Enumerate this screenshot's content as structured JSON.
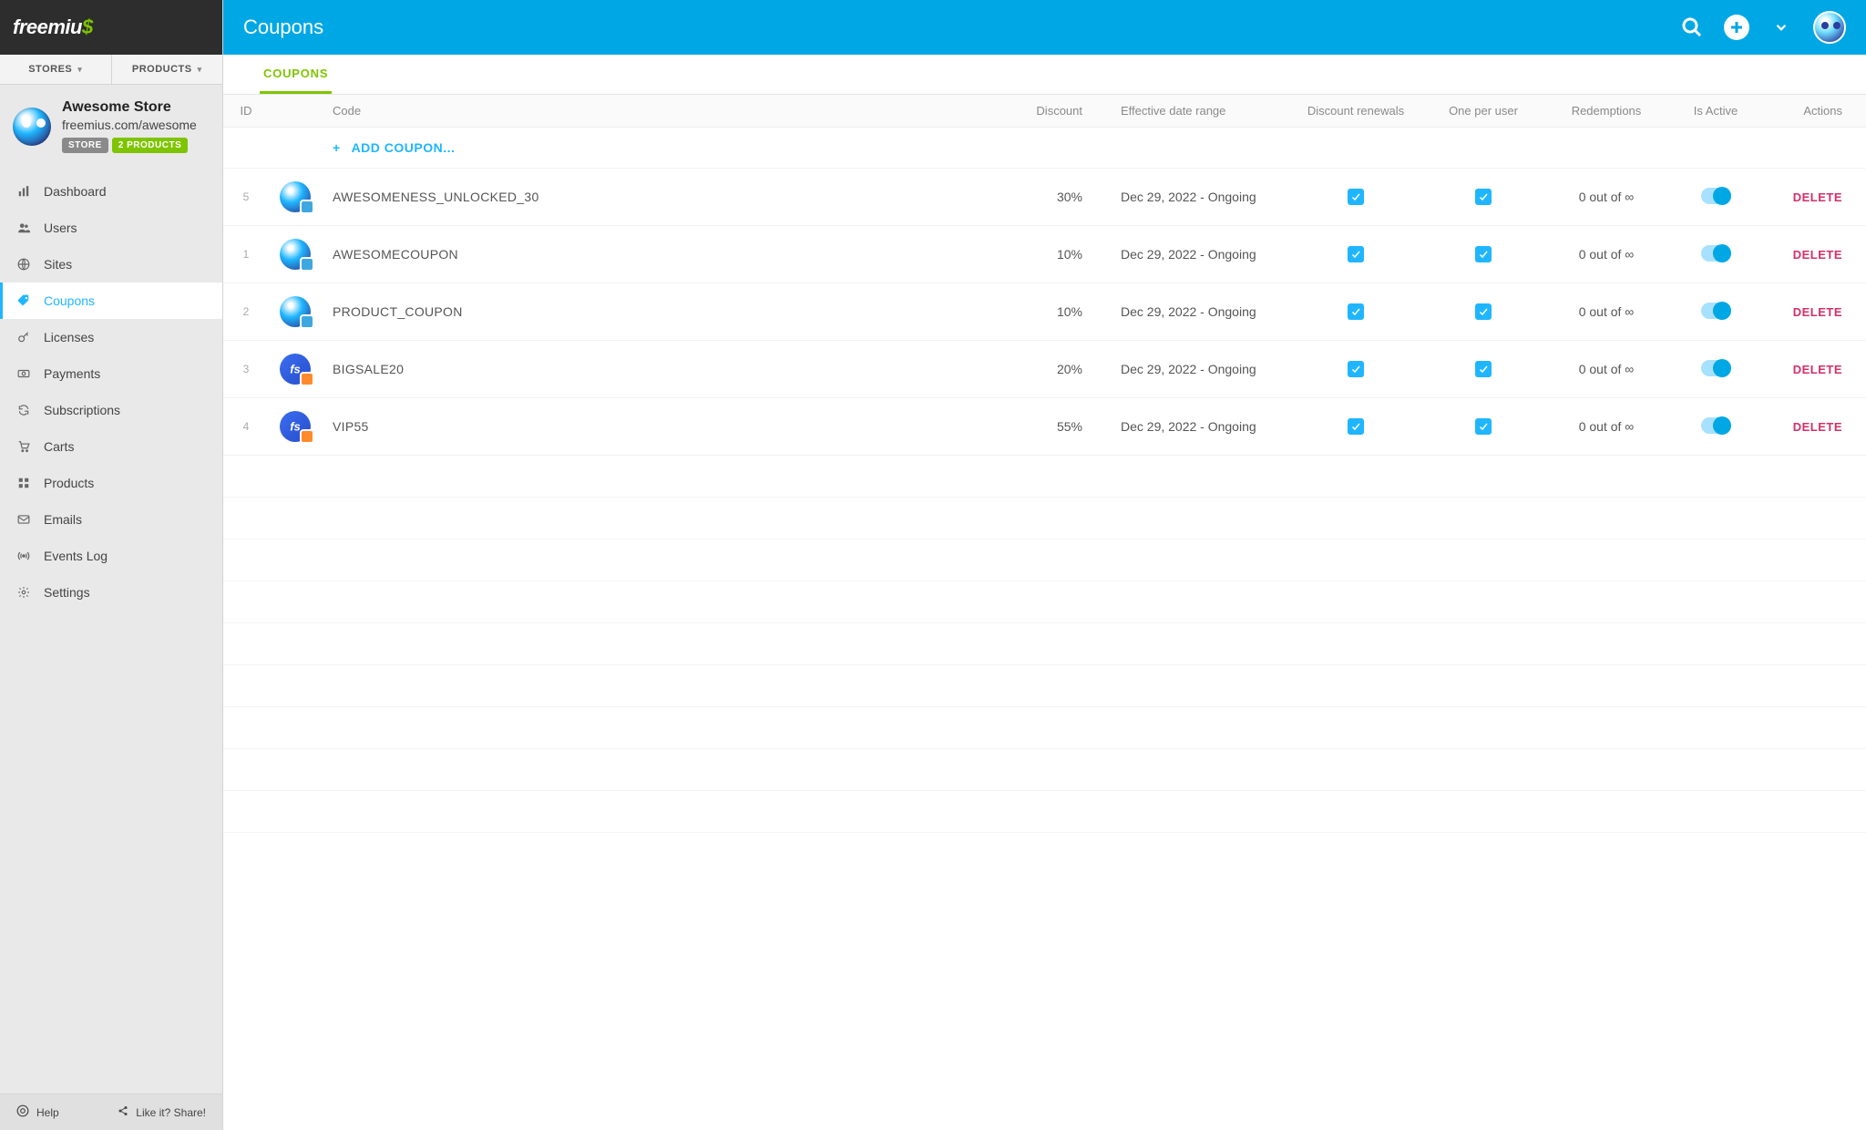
{
  "brand": {
    "name": "freemius"
  },
  "topTabs": {
    "stores": "STORES",
    "products": "PRODUCTS"
  },
  "store": {
    "name": "Awesome Store",
    "url": "freemius.com/awesome",
    "badges": {
      "store": "STORE",
      "products": "2 PRODUCTS"
    }
  },
  "nav": {
    "dashboard": "Dashboard",
    "users": "Users",
    "sites": "Sites",
    "coupons": "Coupons",
    "licenses": "Licenses",
    "payments": "Payments",
    "subscriptions": "Subscriptions",
    "carts": "Carts",
    "products": "Products",
    "emails": "Emails",
    "events": "Events Log",
    "settings": "Settings"
  },
  "footer": {
    "help": "Help",
    "share": "Like it? Share!"
  },
  "header": {
    "title": "Coupons"
  },
  "subtab": {
    "coupons": "COUPONS"
  },
  "columns": {
    "id": "ID",
    "code": "Code",
    "discount": "Discount",
    "range": "Effective date range",
    "renewals": "Discount renewals",
    "oneper": "One per user",
    "redemptions": "Redemptions",
    "active": "Is Active",
    "actions": "Actions"
  },
  "addCoupon": "ADD COUPON...",
  "deleteLabel": "DELETE",
  "rows": [
    {
      "id": "5",
      "iconType": "blue",
      "code": "AWESOMENESS_UNLOCKED_30",
      "discount": "30%",
      "range": "Dec 29, 2022 - Ongoing",
      "renewals": true,
      "oneper": true,
      "redemptions": "0 out of ∞",
      "active": true
    },
    {
      "id": "1",
      "iconType": "blue",
      "code": "AWESOMECOUPON",
      "discount": "10%",
      "range": "Dec 29, 2022 - Ongoing",
      "renewals": true,
      "oneper": true,
      "redemptions": "0 out of ∞",
      "active": true
    },
    {
      "id": "2",
      "iconType": "blue",
      "code": "PRODUCT_COUPON",
      "discount": "10%",
      "range": "Dec 29, 2022 - Ongoing",
      "renewals": true,
      "oneper": true,
      "redemptions": "0 out of ∞",
      "active": true
    },
    {
      "id": "3",
      "iconType": "orange",
      "code": "BIGSALE20",
      "discount": "20%",
      "range": "Dec 29, 2022 - Ongoing",
      "renewals": true,
      "oneper": true,
      "redemptions": "0 out of ∞",
      "active": true
    },
    {
      "id": "4",
      "iconType": "orange",
      "code": "VIP55",
      "discount": "55%",
      "range": "Dec 29, 2022 - Ongoing",
      "renewals": true,
      "oneper": true,
      "redemptions": "0 out of ∞",
      "active": true
    }
  ]
}
